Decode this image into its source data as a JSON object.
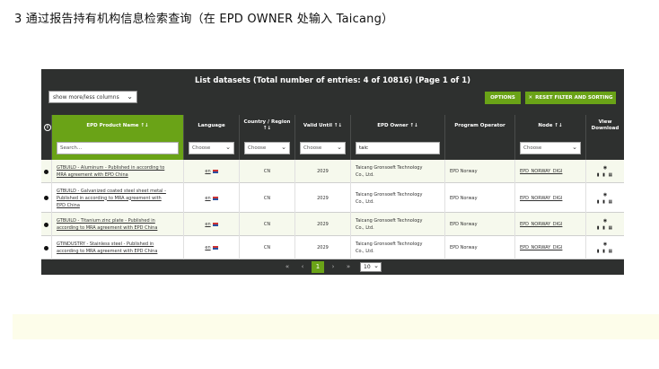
{
  "heading": "3  通过报告持有机构信息检索查询（在 EPD OWNER  处输入  Taicang）",
  "panel": {
    "title": "List datasets (Total number of entries: 4 of 10816) (Page 1 of 1)",
    "column_toggle": "show more/less columns",
    "options_label": "OPTIONS",
    "reset_label": "RESET FILTER AND SORTING"
  },
  "columns": {
    "info": "i",
    "product": "EPD Product Name ↑↓",
    "language": "Language",
    "country_l1": "Country / Region",
    "country_l2": "↑↓",
    "valid": "Valid Until ↑↓",
    "owner": "EPD Owner ↑↓",
    "operator": "Program Operator",
    "node": "Node ↑↓",
    "view_l1": "View",
    "view_l2": "Download"
  },
  "filters": {
    "search_placeholder": "Search...",
    "choose": "Choose",
    "owner_value": "taic"
  },
  "rows": [
    {
      "name_l1": "GTBUILD - Aluminum - Published in according to",
      "name_l2": "MRA agreement with EPD China",
      "name_l3": "",
      "language": "en",
      "country": "CN",
      "valid": "2029",
      "owner_l1": "Taicang Gronsoeft Technology",
      "owner_l2": "Co., Ltd.",
      "operator": "EPD Norway",
      "node": "EPD_NORWAY_DIGI"
    },
    {
      "name_l1": "GTBUILD - Galvanized coated steel sheet metal -",
      "name_l2": "Published in according to MRA agreement with",
      "name_l3": "EPD China",
      "language": "en",
      "country": "CN",
      "valid": "2029",
      "owner_l1": "Taicang Gronsoeft Technology",
      "owner_l2": "Co., Ltd.",
      "operator": "EPD Norway",
      "node": "EPD_NORWAY_DIGI"
    },
    {
      "name_l1": "GTBUILD - Titanium zinc plate - Published in",
      "name_l2": "according to MRA agreement with EPD China",
      "name_l3": "",
      "language": "en",
      "country": "CN",
      "valid": "2029",
      "owner_l1": "Taicang Gronsoeft Technology",
      "owner_l2": "Co., Ltd.",
      "operator": "EPD Norway",
      "node": "EPD_NORWAY_DIGI"
    },
    {
      "name_l1": "GTINDUSTRY - Stainless steel - Published in",
      "name_l2": "according to MRA agreement with EPD China",
      "name_l3": "",
      "language": "en",
      "country": "CN",
      "valid": "2029",
      "owner_l1": "Taicang Gronsoeft Technology",
      "owner_l2": "Co., Ltd.",
      "operator": "EPD Norway",
      "node": "EPD_NORWAY_DIGI"
    }
  ],
  "pager": {
    "first": "«",
    "prev": "‹",
    "current": "1",
    "next": "›",
    "last": "»",
    "page_size": "10"
  },
  "icons": {
    "view": "eye-icon",
    "downloads": "pdf-icon, doc-icon, table-icon",
    "flag": "uk-flag-icon"
  },
  "colors": {
    "accent": "#6aa317",
    "panel_bg": "#2e302f",
    "row_alt": "#f6f9ed"
  }
}
